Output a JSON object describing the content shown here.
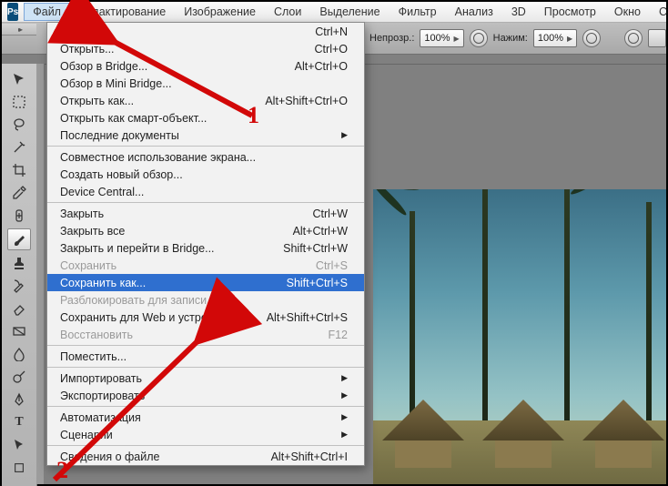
{
  "app": {
    "badge": "Ps"
  },
  "menubar": [
    {
      "id": "file",
      "label": "Файл",
      "active": true
    },
    {
      "id": "edit",
      "label": "Редактирование"
    },
    {
      "id": "image",
      "label": "Изображение"
    },
    {
      "id": "layers",
      "label": "Слои"
    },
    {
      "id": "select",
      "label": "Выделение"
    },
    {
      "id": "filter",
      "label": "Фильтр"
    },
    {
      "id": "analysis",
      "label": "Анализ"
    },
    {
      "id": "3d",
      "label": "3D"
    },
    {
      "id": "view",
      "label": "Просмотр"
    },
    {
      "id": "window",
      "label": "Окно"
    },
    {
      "id": "help",
      "label": "Справ"
    }
  ],
  "optionsbar": {
    "opacity_label": "Непрозр.:",
    "opacity_value": "100%",
    "flow_label": "Нажим:",
    "flow_value": "100%"
  },
  "dropdown": {
    "items": [
      {
        "label": "Создать...",
        "shortcut": "Ctrl+N"
      },
      {
        "label": "Открыть...",
        "shortcut": "Ctrl+O"
      },
      {
        "label": "Обзор в Bridge...",
        "shortcut": "Alt+Ctrl+O"
      },
      {
        "label": "Обзор в Mini Bridge..."
      },
      {
        "label": "Открыть как...",
        "shortcut": "Alt+Shift+Ctrl+O"
      },
      {
        "label": "Открыть как смарт-объект..."
      },
      {
        "label": "Последние документы",
        "submenu": true
      },
      {
        "sep": true
      },
      {
        "label": "Совместное использование экрана..."
      },
      {
        "label": "Создать новый обзор..."
      },
      {
        "label": "Device Central..."
      },
      {
        "sep": true
      },
      {
        "label": "Закрыть",
        "shortcut": "Ctrl+W"
      },
      {
        "label": "Закрыть все",
        "shortcut": "Alt+Ctrl+W"
      },
      {
        "label": "Закрыть и перейти в Bridge...",
        "shortcut": "Shift+Ctrl+W"
      },
      {
        "label": "Сохранить",
        "shortcut": "Ctrl+S",
        "disabled": true
      },
      {
        "label": "Сохранить как...",
        "shortcut": "Shift+Ctrl+S",
        "hover": true
      },
      {
        "label": "Разблокировать для записи...",
        "disabled": true
      },
      {
        "label": "Сохранить для Web и устройств...",
        "shortcut": "Alt+Shift+Ctrl+S"
      },
      {
        "label": "Восстановить",
        "shortcut": "F12",
        "disabled": true
      },
      {
        "sep": true
      },
      {
        "label": "Поместить..."
      },
      {
        "sep": true
      },
      {
        "label": "Импортировать",
        "submenu": true
      },
      {
        "label": "Экспортировать",
        "submenu": true
      },
      {
        "sep": true
      },
      {
        "label": "Автоматизация",
        "submenu": true
      },
      {
        "label": "Сценарии",
        "submenu": true
      },
      {
        "sep": true
      },
      {
        "label": "Сведения о файле",
        "shortcut": "Alt+Shift+Ctrl+I"
      }
    ]
  },
  "annotations": {
    "marker1": "1",
    "marker2": "2"
  }
}
